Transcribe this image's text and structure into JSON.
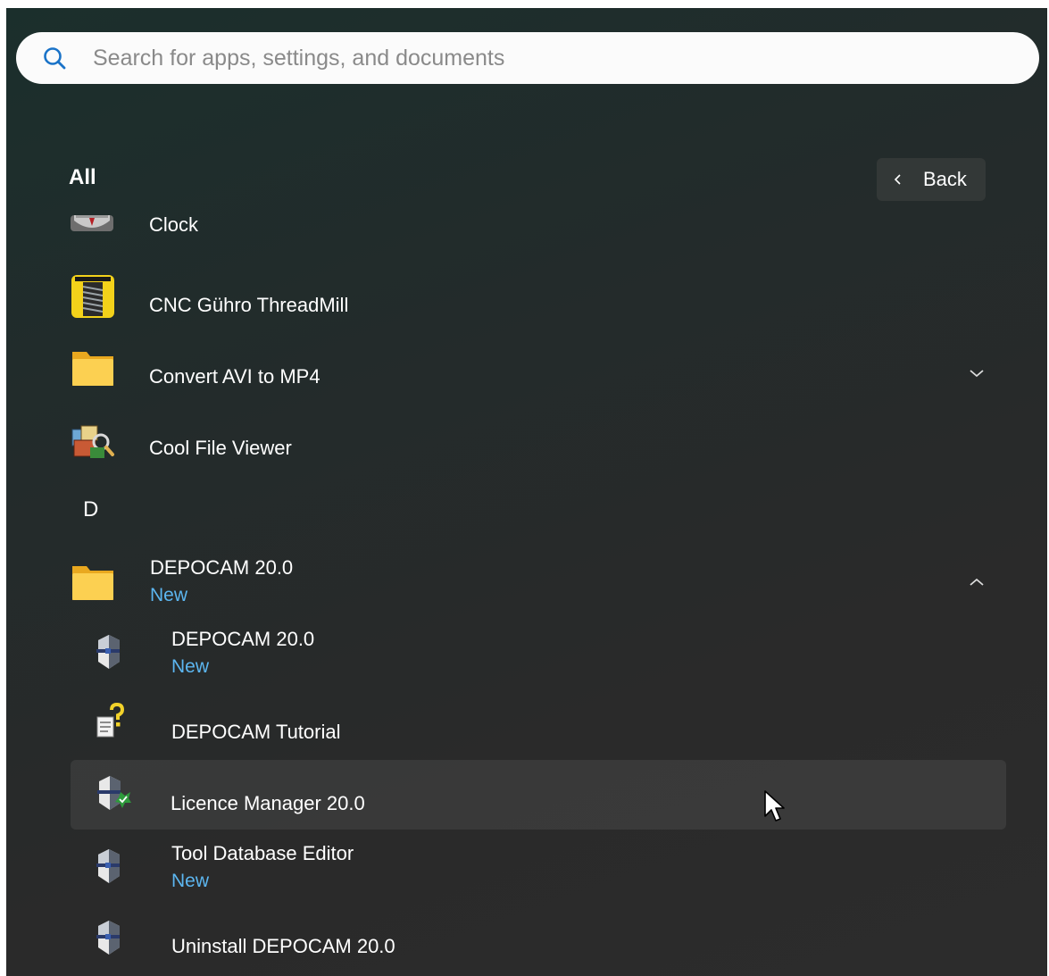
{
  "search": {
    "placeholder": "Search for apps, settings, and documents",
    "icon": "search-icon"
  },
  "header": {
    "title": "All",
    "back_label": "Back"
  },
  "apps": [
    {
      "label": "Clock",
      "icon": "clock-icon"
    },
    {
      "label": "CNC Gühro ThreadMill",
      "icon": "threadmill-icon"
    },
    {
      "label": "Convert AVI to MP4",
      "icon": "folder-icon",
      "expand": "chevron-down-icon"
    },
    {
      "label": "Cool File Viewer",
      "icon": "file-viewer-icon"
    }
  ],
  "group_letter": "D",
  "depocam_folder": {
    "label": "DEPOCAM 20.0",
    "badge": "New",
    "icon": "folder-icon",
    "expand": "chevron-up-icon"
  },
  "depocam_items": [
    {
      "label": "DEPOCAM 20.0",
      "badge": "New",
      "icon": "depocam-icon"
    },
    {
      "label": "DEPOCAM Tutorial",
      "icon": "help-document-icon"
    },
    {
      "label": "Licence Manager 20.0",
      "icon": "licence-manager-icon"
    },
    {
      "label": "Tool Database Editor",
      "badge": "New",
      "icon": "depocam-icon"
    },
    {
      "label": "Uninstall DEPOCAM 20.0",
      "icon": "depocam-icon"
    }
  ],
  "colors": {
    "accent_badge": "#5cb6f0",
    "panel_bg": "#2a2a2a",
    "hover_row": "#353a39"
  }
}
